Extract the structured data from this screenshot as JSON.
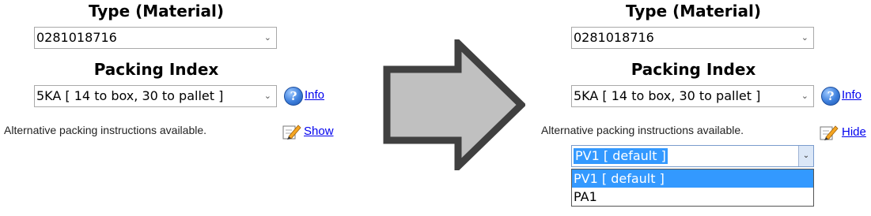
{
  "before": {
    "type_heading": "Type (Material)",
    "type_value": "0281018716",
    "packing_heading": "Packing Index",
    "packing_value": "5KA [ 14 to box, 30 to pallet ]",
    "info_icon_glyph": "?",
    "info_link": "Info",
    "alt_note": "Alternative packing instructions available.",
    "toggle_link": "Show"
  },
  "after": {
    "type_heading": "Type (Material)",
    "type_value": "0281018716",
    "packing_heading": "Packing Index",
    "packing_value": "5KA [ 14 to box, 30 to pallet ]",
    "info_icon_glyph": "?",
    "info_link": "Info",
    "alt_note": "Alternative packing instructions available.",
    "toggle_link": "Hide",
    "alt_select_value": "PV1 [ default ]",
    "alt_options": [
      "PV1 [ default ]",
      "PA1"
    ]
  },
  "colors": {
    "arrow_fill": "#c0c0c0",
    "arrow_outline": "#404040",
    "link": "#0000ee",
    "selection": "#3399ff"
  },
  "icons": {
    "chevron": "chevron-down-icon",
    "info": "info-icon",
    "edit": "pencil-edit-icon",
    "arrow": "right-arrow-icon"
  }
}
